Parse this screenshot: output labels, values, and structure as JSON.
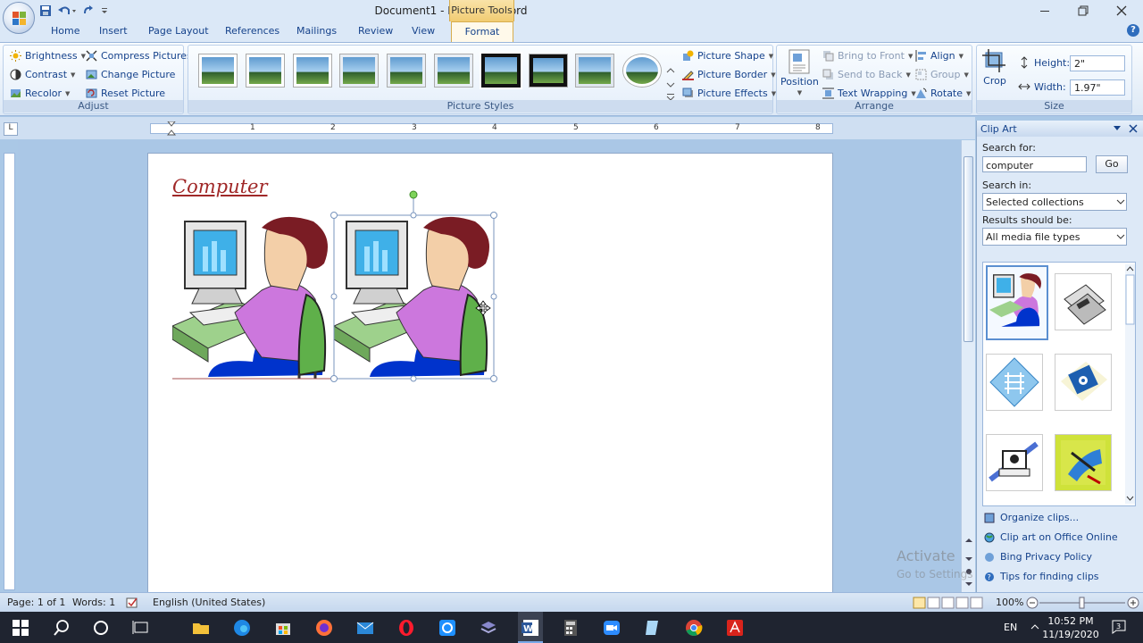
{
  "window": {
    "title": "Document1 - Microsoft Word",
    "contextual_tab": "Picture Tools"
  },
  "tabs": [
    "Home",
    "Insert",
    "Page Layout",
    "References",
    "Mailings",
    "Review",
    "View",
    "Format"
  ],
  "active_tab": "Format",
  "ribbon": {
    "adjust": {
      "title": "Adjust",
      "brightness": "Brightness",
      "contrast": "Contrast",
      "recolor": "Recolor",
      "compress": "Compress Pictures",
      "change": "Change Picture",
      "reset": "Reset Picture"
    },
    "styles": {
      "title": "Picture Styles",
      "shape": "Picture Shape",
      "border": "Picture Border",
      "effects": "Picture Effects"
    },
    "arrange": {
      "title": "Arrange",
      "position": "Position",
      "bring_front": "Bring to Front",
      "send_back": "Send to Back",
      "text_wrapping": "Text Wrapping",
      "align": "Align",
      "group": "Group",
      "rotate": "Rotate"
    },
    "size": {
      "title": "Size",
      "crop": "Crop",
      "height_label": "Height:",
      "height_value": "2\"",
      "width_label": "Width:",
      "width_value": "1.97\""
    }
  },
  "ruler_numbers": [
    "1",
    "2",
    "3",
    "4",
    "5",
    "6",
    "7",
    "8"
  ],
  "document": {
    "heading": "Computer"
  },
  "clip_art": {
    "title": "Clip Art",
    "search_for_label": "Search for:",
    "search_value": "computer",
    "go": "Go",
    "search_in_label": "Search in:",
    "search_in_value": "Selected collections",
    "results_label": "Results should be:",
    "results_value": "All media file types",
    "links": [
      "Organize clips...",
      "Clip art on Office Online",
      "Bing Privacy Policy",
      "Tips for finding clips"
    ]
  },
  "status": {
    "page": "Page: 1 of 1",
    "words": "Words: 1",
    "language": "English (United States)",
    "zoom": "100%"
  },
  "watermark": {
    "line1": "Activate",
    "line2": "Go to Settings"
  },
  "taskbar": {
    "lang": "EN",
    "time": "10:52 PM",
    "date": "11/19/2020"
  },
  "colors": {
    "ribbon_text": "#15428b",
    "heading": "#a02828",
    "contextual": "#f1cc73"
  }
}
